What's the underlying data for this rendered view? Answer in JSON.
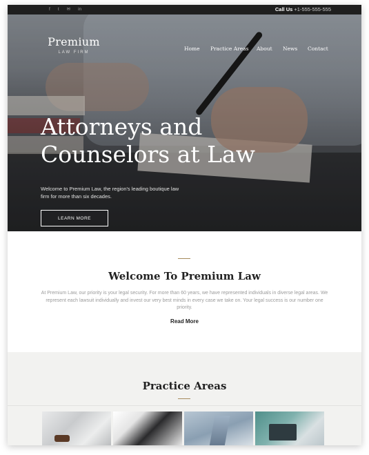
{
  "topbar": {
    "social": [
      "f",
      "t",
      "✉",
      "in"
    ],
    "call_label": "Call Us",
    "phone": "+1-555-555-555"
  },
  "logo": {
    "name": "Premium",
    "subtitle": "LAW FIRM"
  },
  "nav": {
    "items": [
      "Home",
      "Practice Areas",
      "About",
      "News",
      "Contact"
    ]
  },
  "hero": {
    "headline_line1": "Attorneys and",
    "headline_line2": "Counselors at Law",
    "text": "Welcome to Premium Law, the region's leading boutique law firm for more than six decades.",
    "button_label": "LEARN MORE"
  },
  "welcome": {
    "title": "Welcome To Premium Law",
    "body": "At Premium Law, our priority is your legal security. For more than 60 years, we have represented individuals in diverse legal areas. We represent each lawsuit individually and invest our very best minds in every case we take on. Your legal success is our number one priority.",
    "link_label": "Read More"
  },
  "practice": {
    "title": "Practice Areas"
  },
  "colors": {
    "accent": "#a58a5c",
    "topbar": "#1f1f1f",
    "section_bg": "#f2f2f0"
  }
}
